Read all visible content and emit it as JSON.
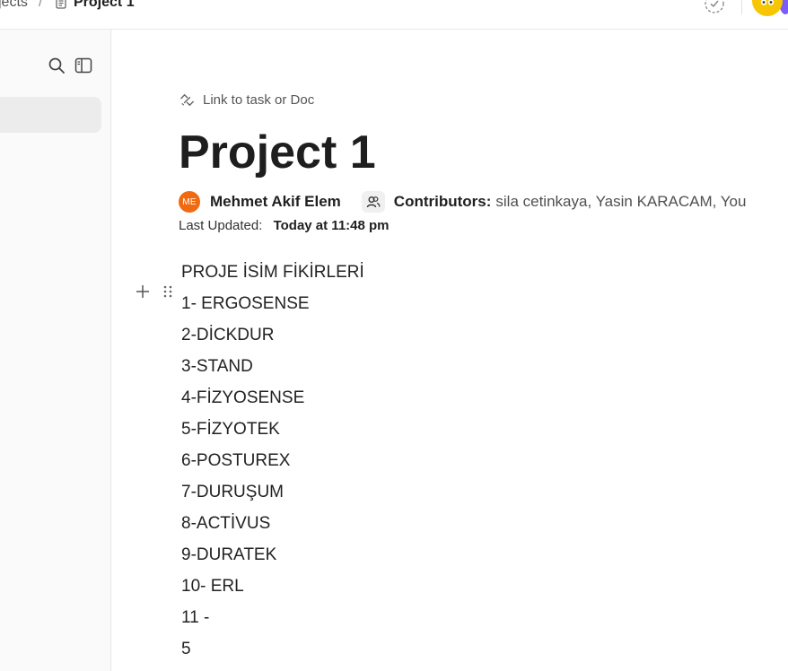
{
  "topbar": {
    "breadcrumb_prev": "jects",
    "breadcrumb_sep": "/",
    "breadcrumb_current": "Project 1",
    "icons": [
      "document-icon",
      "status-circle-icon",
      "avatar-icon"
    ],
    "colors": {
      "avatar": "#f7c600",
      "avatar_edge": "#7b5cf5"
    }
  },
  "sidebar": {
    "icons": [
      "search-icon",
      "sidebar-panel-icon"
    ]
  },
  "doc": {
    "link_text": "Link to task or Doc",
    "title": "Project 1",
    "author_initials": "ME",
    "author_name": "Mehmet Akif Elem",
    "contributors_label": "Contributors:",
    "contributors_names": "sila cetinkaya, Yasin KARACAM, You",
    "last_updated_label": "Last Updated:",
    "last_updated_value": "Today at 11:48 pm",
    "colors": {
      "author_avatar": "#f06a12"
    }
  },
  "content": {
    "lines": [
      "PROJE İSİM FİKİRLERİ",
      "1- ERGOSENSE",
      "2-DİCKDUR",
      "3-STAND",
      "4-FİZYOSENSE",
      "5-FİZYOTEK",
      "6-POSTUREX",
      "7-DURUŞUM",
      "8-ACTİVUS",
      "9-DURATEK",
      "10- ERL",
      "11 -",
      "5"
    ]
  }
}
